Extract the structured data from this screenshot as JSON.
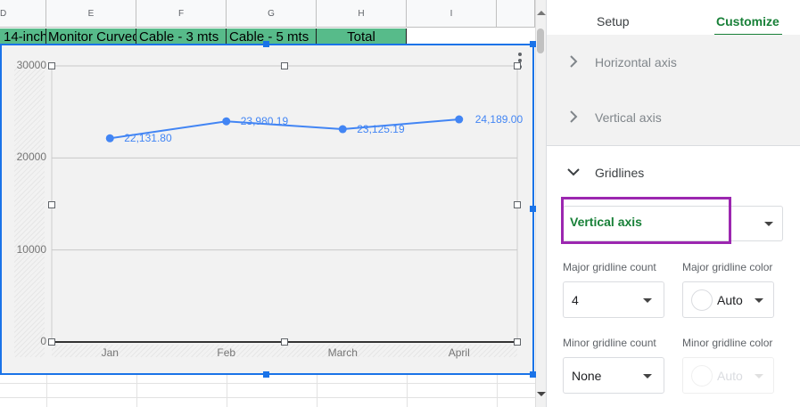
{
  "sheet": {
    "columns": [
      "D",
      "E",
      "F",
      "G",
      "H",
      "I"
    ],
    "header_cells": [
      "14-inch",
      "Monitor Curved",
      "Cable - 3 mts",
      "Cable - 5 mts",
      "Total"
    ]
  },
  "chart_data": {
    "type": "line",
    "categories": [
      "Jan",
      "Feb",
      "March",
      "April"
    ],
    "values": [
      22131.8,
      23980.19,
      23125.19,
      24189.0
    ],
    "data_labels": [
      "22,131.80",
      "23,980.19",
      "23,125.19",
      "24,189.00"
    ],
    "y_ticks": [
      "30000",
      "20000",
      "10000",
      "0"
    ],
    "ylim": [
      0,
      30000
    ],
    "grid": true,
    "series_color": "#4285f4"
  },
  "panel": {
    "tabs": [
      "Setup",
      "Customize"
    ],
    "active_tab": "Customize",
    "accent": "#188038",
    "sections": {
      "horizontal_axis": "Horizontal axis",
      "vertical_axis": "Vertical axis",
      "gridlines": "Gridlines"
    },
    "axis_select": "Vertical axis",
    "major_count_label": "Major gridline count",
    "major_count_value": "4",
    "major_color_label": "Major gridline color",
    "major_color_value": "Auto",
    "minor_count_label": "Minor gridline count",
    "minor_count_value": "None",
    "minor_color_label": "Minor gridline color",
    "minor_color_value": "Auto"
  }
}
